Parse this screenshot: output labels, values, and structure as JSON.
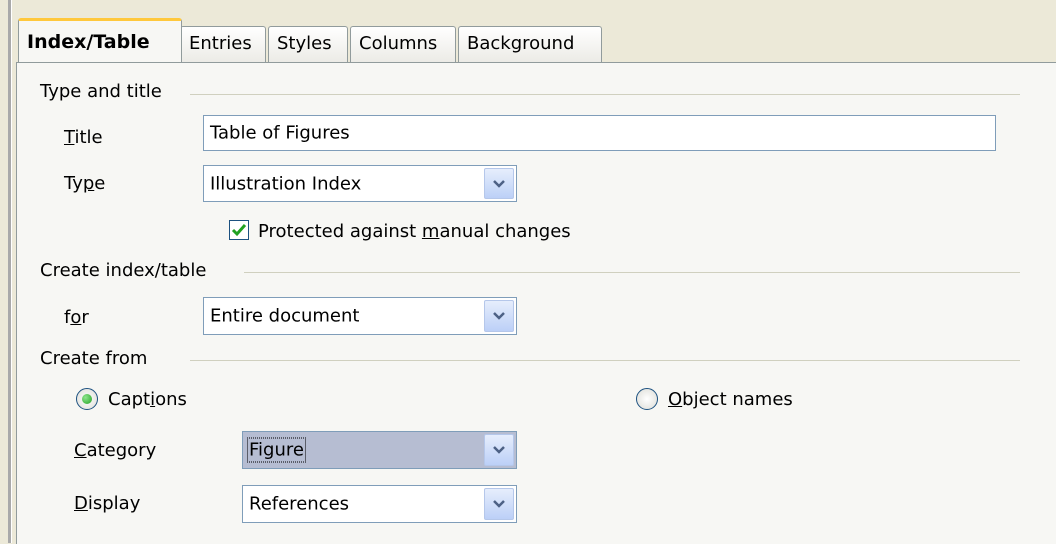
{
  "tabs": [
    {
      "label": "Index/Table",
      "active": true
    },
    {
      "label": "Entries",
      "active": false
    },
    {
      "label": "Styles",
      "active": false
    },
    {
      "label": "Columns",
      "active": false
    },
    {
      "label": "Background",
      "active": false
    }
  ],
  "type_and_title": {
    "heading": "Type and title",
    "title_label_u": "T",
    "title_label_rest": "itle",
    "title_value": "Table of Figures",
    "type_label_pre": "Ty",
    "type_label_u": "p",
    "type_label_post": "e",
    "type_value": "Illustration Index",
    "protected_pre": "Protected against ",
    "protected_u": "m",
    "protected_post": "anual changes",
    "protected_checked": true
  },
  "create_index": {
    "heading": "Create index/table",
    "for_label_pre": "f",
    "for_label_u": "o",
    "for_label_post": "r",
    "for_value": "Entire document"
  },
  "create_from": {
    "heading": "Create from",
    "captions_pre": "Capt",
    "captions_u": "i",
    "captions_post": "ons",
    "captions_selected": true,
    "object_names_u": "O",
    "object_names_rest": "bject names",
    "object_names_selected": false,
    "category_label_u": "C",
    "category_label_rest": "ategory",
    "category_value": "Figure",
    "display_label_u": "D",
    "display_label_rest": "isplay",
    "display_value": "References"
  },
  "icons": {
    "dropdown": "chevron-down-icon",
    "check": "checkmark-icon",
    "radio": "radio-dot-icon"
  },
  "colors": {
    "active_tab_accent": "#ffc83c",
    "field_border": "#7f9db9",
    "check_green": "#21a121",
    "selection_bg": "#b6bdd2"
  }
}
